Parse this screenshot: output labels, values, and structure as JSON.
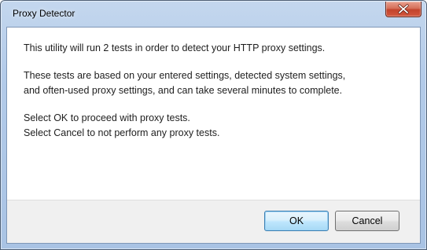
{
  "window": {
    "title": "Proxy Detector"
  },
  "message": {
    "line1": "This utility will run 2 tests in order to detect your HTTP proxy settings.",
    "paragraph2_line1": "These tests are based on your entered settings, detected system settings,",
    "paragraph2_line2": "and often-used proxy settings, and can take several minutes to complete.",
    "paragraph3_line1": "Select OK to proceed with proxy tests.",
    "paragraph3_line2": "Select Cancel to not perform any proxy tests."
  },
  "buttons": {
    "ok_label": "OK",
    "cancel_label": "Cancel"
  },
  "icons": {
    "close": "close-icon"
  },
  "colors": {
    "title_bar": "#b3cbe9",
    "close_button": "#c3432c",
    "default_button_border": "#3c7fb1"
  }
}
